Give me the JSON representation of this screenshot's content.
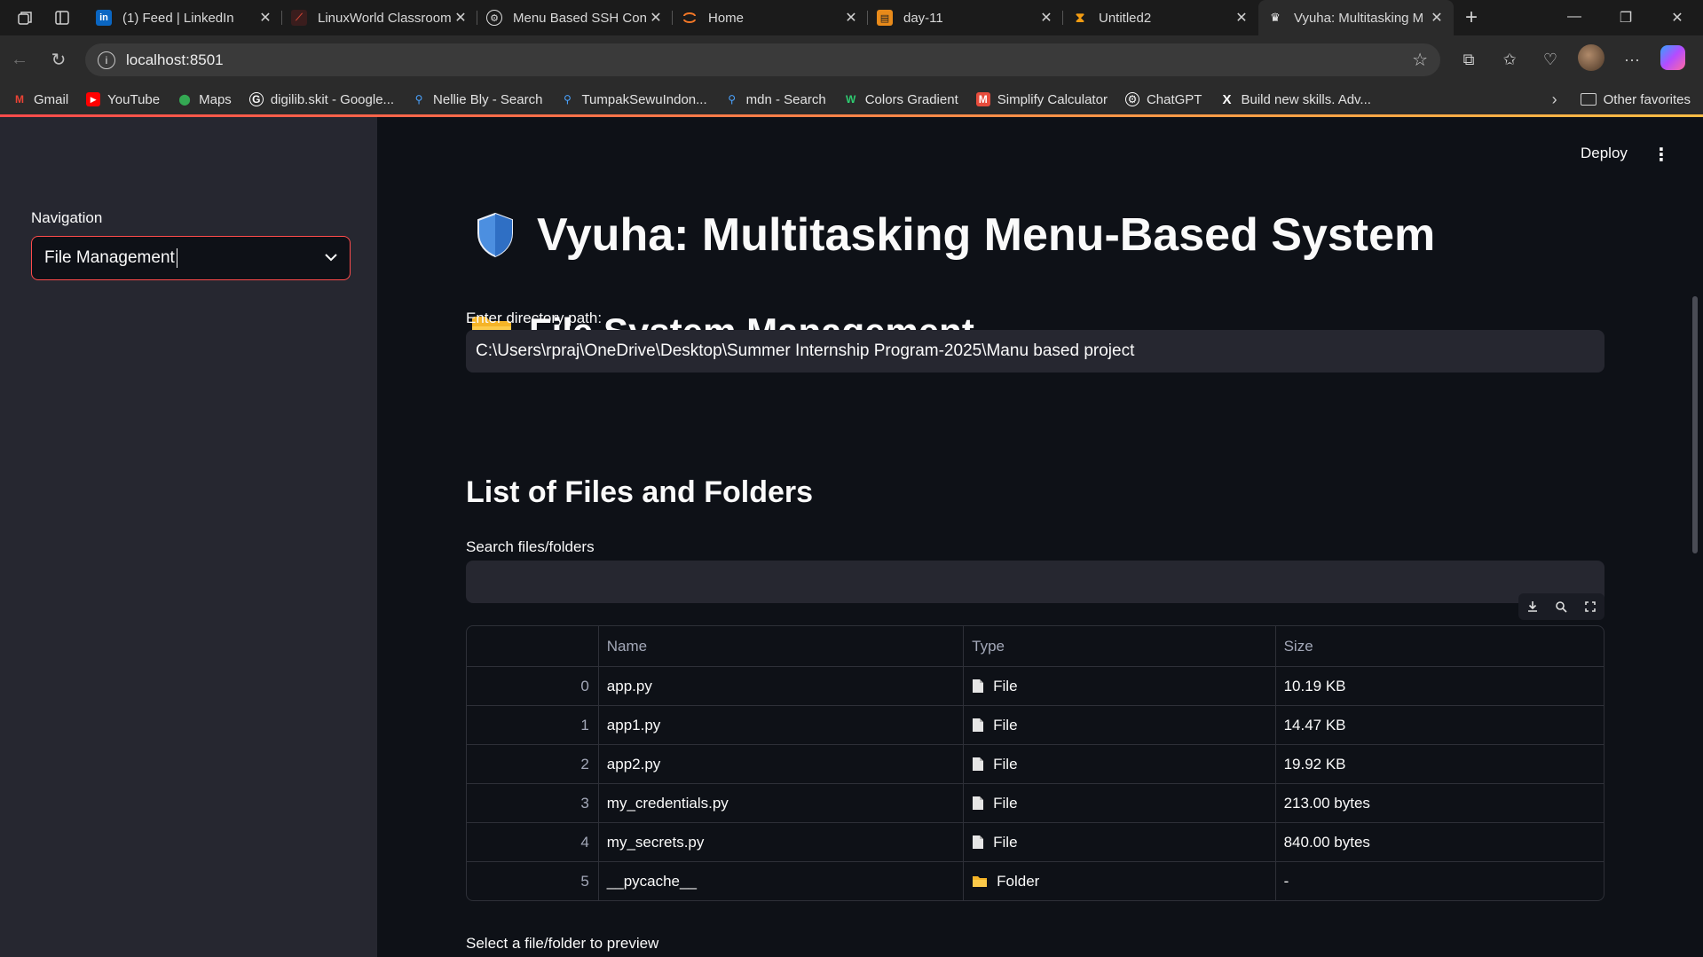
{
  "browser": {
    "tabs": [
      {
        "title": "(1) Feed | LinkedIn",
        "icon": "linkedin-icon",
        "active": false
      },
      {
        "title": "LinuxWorld Classroom",
        "icon": "linuxworld-icon",
        "active": false
      },
      {
        "title": "Menu Based SSH Con",
        "icon": "chatgpt-icon",
        "active": false
      },
      {
        "title": "Home",
        "icon": "jupyter-icon",
        "active": false
      },
      {
        "title": "day-11",
        "icon": "notebook-icon",
        "active": false
      },
      {
        "title": "Untitled2",
        "icon": "hourglass-icon",
        "active": false
      },
      {
        "title": "Vyuha: Multitasking M",
        "icon": "streamlit-icon",
        "active": true
      }
    ],
    "url": "localhost:8501",
    "bookmarks": [
      {
        "label": "Gmail",
        "icon": "gmail-icon",
        "color": "#ea4335"
      },
      {
        "label": "YouTube",
        "icon": "youtube-icon",
        "color": "#ff0000"
      },
      {
        "label": "Maps",
        "icon": "maps-icon",
        "color": "#34a853"
      },
      {
        "label": "digilib.skit - Google...",
        "icon": "google-icon",
        "color": "#ffffff"
      },
      {
        "label": "Nellie Bly - Search",
        "icon": "search-icon",
        "color": "#4aa3ff"
      },
      {
        "label": "TumpakSewuIndon...",
        "icon": "search-icon",
        "color": "#4aa3ff"
      },
      {
        "label": "mdn - Search",
        "icon": "search-icon",
        "color": "#4aa3ff"
      },
      {
        "label": "Colors Gradient",
        "icon": "gradient-icon",
        "color": "#2ecc71"
      },
      {
        "label": "Simplify Calculator",
        "icon": "calculator-icon",
        "color": "#e74c3c"
      },
      {
        "label": "ChatGPT",
        "icon": "chatgpt-icon",
        "color": "#ffffff"
      },
      {
        "label": "Build new skills. Adv...",
        "icon": "x-icon",
        "color": "#ffffff"
      }
    ],
    "other_favorites": "Other favorites"
  },
  "app": {
    "deploy_label": "Deploy",
    "sidebar": {
      "nav_label": "Navigation",
      "selected": "File Management"
    },
    "title": "Vyuha: Multitasking Menu-Based System",
    "section_title": "File System Management",
    "dir_label": "Enter directory path:",
    "dir_value": "C:\\Users\\rpraj\\OneDrive\\Desktop\\Summer Internship Program-2025\\Manu based project",
    "list_title": "List of Files and Folders",
    "search_label": "Search files/folders",
    "search_value": "",
    "table": {
      "columns": [
        "",
        "Name",
        "Type",
        "Size"
      ],
      "rows": [
        {
          "idx": "0",
          "name": "app.py",
          "type": "File",
          "size": "10.19 KB"
        },
        {
          "idx": "1",
          "name": "app1.py",
          "type": "File",
          "size": "14.47 KB"
        },
        {
          "idx": "2",
          "name": "app2.py",
          "type": "File",
          "size": "19.92 KB"
        },
        {
          "idx": "3",
          "name": "my_credentials.py",
          "type": "File",
          "size": "213.00 bytes"
        },
        {
          "idx": "4",
          "name": "my_secrets.py",
          "type": "File",
          "size": "840.00 bytes"
        },
        {
          "idx": "5",
          "name": "__pycache__",
          "type": "Folder",
          "size": "-"
        }
      ]
    },
    "preview_label": "Select a file/folder to preview"
  }
}
